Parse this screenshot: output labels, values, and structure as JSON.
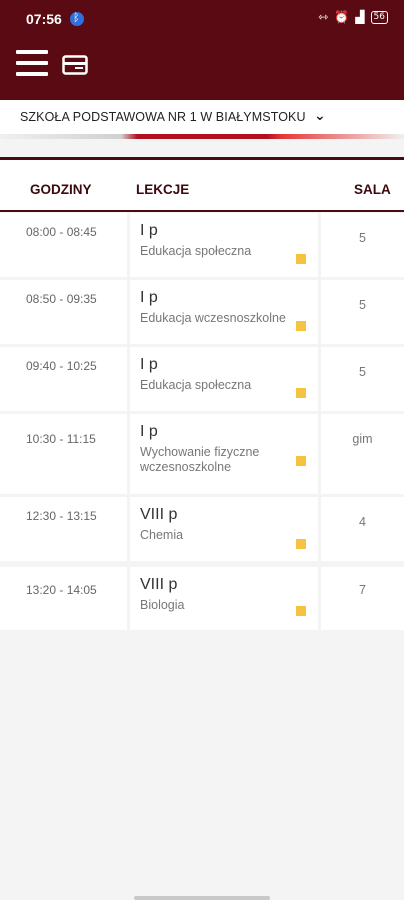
{
  "status_bar": {
    "time": "07:56",
    "icons": [
      "bluetooth-icon",
      "data-saver-icon",
      "alarm-icon",
      "signal-icon",
      "battery-icon"
    ],
    "battery": "56",
    "signal_text": "⁴ᴳ"
  },
  "app_bar": {
    "color": "#5a0a12"
  },
  "school": {
    "name": "SZKOŁA PODSTAWOWA NR 1 W BIAŁYMSTOKU"
  },
  "table": {
    "headers": {
      "hours": "GODZINY",
      "lessons": "LEKCJE",
      "room": "SALA"
    },
    "rows": [
      {
        "time": "08:00 - 08:45",
        "class": "I p",
        "subject": "Edukacja społeczna",
        "room": "5"
      },
      {
        "time": "08:50 - 09:35",
        "class": "I p",
        "subject": "Edukacja wczesnoszkolne",
        "room": "5"
      },
      {
        "time": "09:40 - 10:25",
        "class": "I p",
        "subject": "Edukacja społeczna",
        "room": "5"
      },
      {
        "time": "10:30 - 11:15",
        "class": "I p",
        "subject": "Wychowanie fizyczne wczesnoszkolne",
        "room": "gim"
      },
      {
        "time": "12:30 - 13:15",
        "class": "VIII p",
        "subject": "Chemia",
        "room": "4"
      },
      {
        "time": "13:20 - 14:05",
        "class": "VIII p",
        "subject": "Biologia",
        "room": "7"
      }
    ],
    "flag_color": "#f5c242"
  }
}
